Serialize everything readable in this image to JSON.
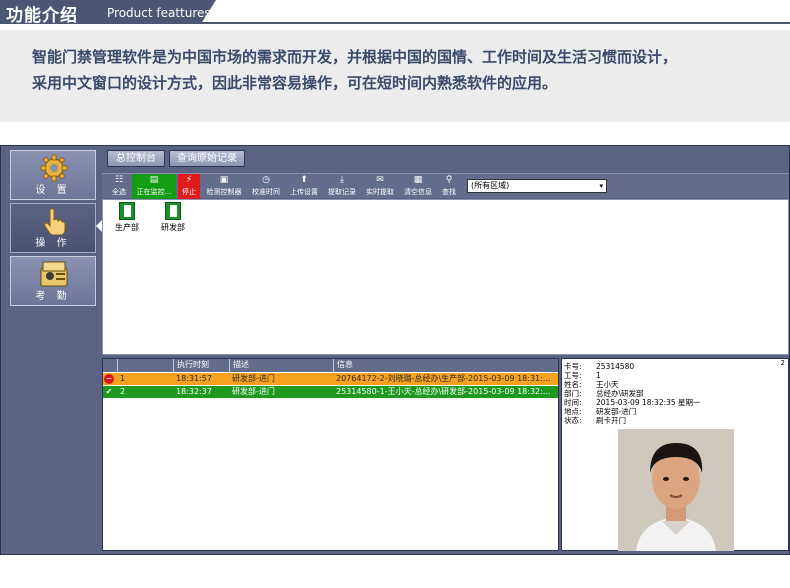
{
  "header": {
    "title": "功能介绍",
    "subtitle": "Product feattures"
  },
  "description": {
    "line1": "智能门禁管理软件是为中国市场的需求而开发，并根据中国的国情、工作时间及生活习惯而设计，",
    "line2": "采用中文窗口的设计方式，因此非常容易操作，可在短时间内熟悉软件的应用。"
  },
  "nav": {
    "items": [
      {
        "label": "设 置",
        "icon": "gear-icon"
      },
      {
        "label": "操 作",
        "icon": "hand-pointer-icon"
      },
      {
        "label": "考 勤",
        "icon": "attendance-card-icon"
      }
    ],
    "active_index": 1
  },
  "tabs": {
    "main_console": "总控制台",
    "query_raw": "查询原始记录"
  },
  "toolbar": {
    "select_all": "全选",
    "monitoring": "正在监控...",
    "stop": "停止",
    "check_controller": "检测控制器",
    "calibrate_time": "校准时间",
    "upload_settings": "上传设置",
    "fetch_records": "提取记录",
    "realtime_fetch": "实时提取",
    "clear_info": "清空信息",
    "search": "查找",
    "area_select": "(所有区域)"
  },
  "doors": [
    {
      "label": "生产部"
    },
    {
      "label": "研发部"
    }
  ],
  "grid": {
    "columns": [
      "执行时刻",
      "描述",
      "信息"
    ],
    "rows": [
      {
        "index": "1",
        "time": "18:31:57",
        "desc": "研发部-进门",
        "info": "20764172-2-刘晓璐-总经办\\生产部-2015-03-09 18:31:...",
        "status": "denied"
      },
      {
        "index": "2",
        "time": "18:32:37",
        "desc": "研发部-进门",
        "info": "25314580-1-王小天-总经办\\研发部-2015-03-09 18:32:...",
        "status": "granted"
      }
    ]
  },
  "detail": {
    "corner_number": "2",
    "card_no_label": "卡号:",
    "card_no": "25314580",
    "emp_no_label": "工号:",
    "emp_no": "1",
    "name_label": "姓名:",
    "name": "王小天",
    "dept_label": "部门:",
    "dept": "总经办\\研发部",
    "time_label": "时间:",
    "time": "2015-03-09 18:32:35 星期一",
    "location_label": "地点:",
    "location": "研发部-进门",
    "state_label": "状态:",
    "state": "刷卡开门"
  },
  "colors": {
    "header_bar": "#4a5674",
    "app_background": "#5b6384",
    "row_denied": "#f7a21e",
    "row_granted": "#1d9a1d",
    "monitoring_button": "#149c14",
    "stop_button": "#e11b1b"
  }
}
